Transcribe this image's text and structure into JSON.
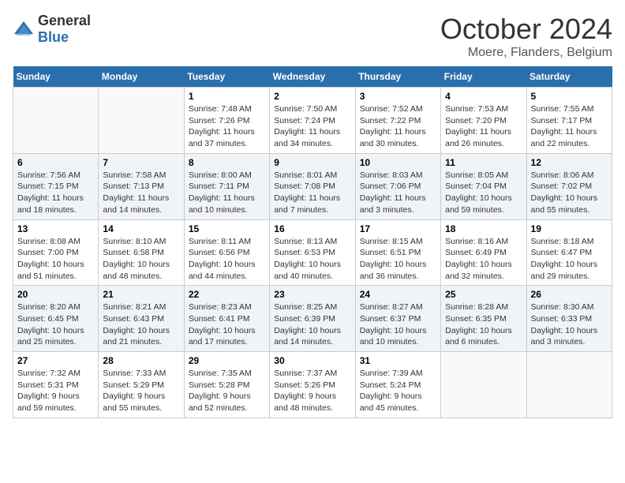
{
  "header": {
    "logo_general": "General",
    "logo_blue": "Blue",
    "month": "October 2024",
    "location": "Moere, Flanders, Belgium"
  },
  "weekdays": [
    "Sunday",
    "Monday",
    "Tuesday",
    "Wednesday",
    "Thursday",
    "Friday",
    "Saturday"
  ],
  "weeks": [
    [
      {
        "day": "",
        "content": ""
      },
      {
        "day": "",
        "content": ""
      },
      {
        "day": "1",
        "content": "Sunrise: 7:48 AM\nSunset: 7:26 PM\nDaylight: 11 hours and 37 minutes."
      },
      {
        "day": "2",
        "content": "Sunrise: 7:50 AM\nSunset: 7:24 PM\nDaylight: 11 hours and 34 minutes."
      },
      {
        "day": "3",
        "content": "Sunrise: 7:52 AM\nSunset: 7:22 PM\nDaylight: 11 hours and 30 minutes."
      },
      {
        "day": "4",
        "content": "Sunrise: 7:53 AM\nSunset: 7:20 PM\nDaylight: 11 hours and 26 minutes."
      },
      {
        "day": "5",
        "content": "Sunrise: 7:55 AM\nSunset: 7:17 PM\nDaylight: 11 hours and 22 minutes."
      }
    ],
    [
      {
        "day": "6",
        "content": "Sunrise: 7:56 AM\nSunset: 7:15 PM\nDaylight: 11 hours and 18 minutes."
      },
      {
        "day": "7",
        "content": "Sunrise: 7:58 AM\nSunset: 7:13 PM\nDaylight: 11 hours and 14 minutes."
      },
      {
        "day": "8",
        "content": "Sunrise: 8:00 AM\nSunset: 7:11 PM\nDaylight: 11 hours and 10 minutes."
      },
      {
        "day": "9",
        "content": "Sunrise: 8:01 AM\nSunset: 7:08 PM\nDaylight: 11 hours and 7 minutes."
      },
      {
        "day": "10",
        "content": "Sunrise: 8:03 AM\nSunset: 7:06 PM\nDaylight: 11 hours and 3 minutes."
      },
      {
        "day": "11",
        "content": "Sunrise: 8:05 AM\nSunset: 7:04 PM\nDaylight: 10 hours and 59 minutes."
      },
      {
        "day": "12",
        "content": "Sunrise: 8:06 AM\nSunset: 7:02 PM\nDaylight: 10 hours and 55 minutes."
      }
    ],
    [
      {
        "day": "13",
        "content": "Sunrise: 8:08 AM\nSunset: 7:00 PM\nDaylight: 10 hours and 51 minutes."
      },
      {
        "day": "14",
        "content": "Sunrise: 8:10 AM\nSunset: 6:58 PM\nDaylight: 10 hours and 48 minutes."
      },
      {
        "day": "15",
        "content": "Sunrise: 8:11 AM\nSunset: 6:56 PM\nDaylight: 10 hours and 44 minutes."
      },
      {
        "day": "16",
        "content": "Sunrise: 8:13 AM\nSunset: 6:53 PM\nDaylight: 10 hours and 40 minutes."
      },
      {
        "day": "17",
        "content": "Sunrise: 8:15 AM\nSunset: 6:51 PM\nDaylight: 10 hours and 36 minutes."
      },
      {
        "day": "18",
        "content": "Sunrise: 8:16 AM\nSunset: 6:49 PM\nDaylight: 10 hours and 32 minutes."
      },
      {
        "day": "19",
        "content": "Sunrise: 8:18 AM\nSunset: 6:47 PM\nDaylight: 10 hours and 29 minutes."
      }
    ],
    [
      {
        "day": "20",
        "content": "Sunrise: 8:20 AM\nSunset: 6:45 PM\nDaylight: 10 hours and 25 minutes."
      },
      {
        "day": "21",
        "content": "Sunrise: 8:21 AM\nSunset: 6:43 PM\nDaylight: 10 hours and 21 minutes."
      },
      {
        "day": "22",
        "content": "Sunrise: 8:23 AM\nSunset: 6:41 PM\nDaylight: 10 hours and 17 minutes."
      },
      {
        "day": "23",
        "content": "Sunrise: 8:25 AM\nSunset: 6:39 PM\nDaylight: 10 hours and 14 minutes."
      },
      {
        "day": "24",
        "content": "Sunrise: 8:27 AM\nSunset: 6:37 PM\nDaylight: 10 hours and 10 minutes."
      },
      {
        "day": "25",
        "content": "Sunrise: 8:28 AM\nSunset: 6:35 PM\nDaylight: 10 hours and 6 minutes."
      },
      {
        "day": "26",
        "content": "Sunrise: 8:30 AM\nSunset: 6:33 PM\nDaylight: 10 hours and 3 minutes."
      }
    ],
    [
      {
        "day": "27",
        "content": "Sunrise: 7:32 AM\nSunset: 5:31 PM\nDaylight: 9 hours and 59 minutes."
      },
      {
        "day": "28",
        "content": "Sunrise: 7:33 AM\nSunset: 5:29 PM\nDaylight: 9 hours and 55 minutes."
      },
      {
        "day": "29",
        "content": "Sunrise: 7:35 AM\nSunset: 5:28 PM\nDaylight: 9 hours and 52 minutes."
      },
      {
        "day": "30",
        "content": "Sunrise: 7:37 AM\nSunset: 5:26 PM\nDaylight: 9 hours and 48 minutes."
      },
      {
        "day": "31",
        "content": "Sunrise: 7:39 AM\nSunset: 5:24 PM\nDaylight: 9 hours and 45 minutes."
      },
      {
        "day": "",
        "content": ""
      },
      {
        "day": "",
        "content": ""
      }
    ]
  ]
}
